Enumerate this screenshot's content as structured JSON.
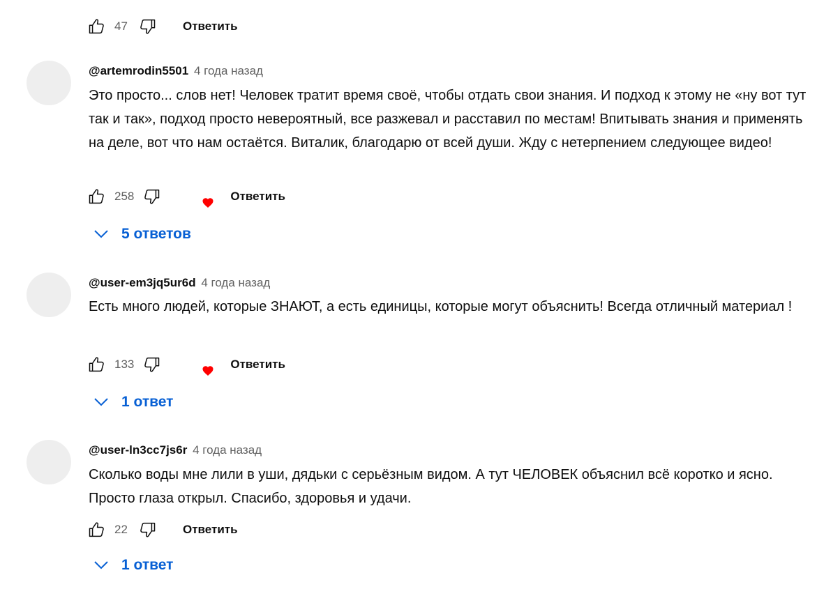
{
  "top_actions": {
    "like_count": "47",
    "reply_label": "Ответить"
  },
  "comments": [
    {
      "author": "@artemrodin5501",
      "time": "4 года назад",
      "text": "Это просто... слов нет! Человек тратит время своё, чтобы отдать свои знания. И подход к этому не «ну вот тут так и так», подход просто невероятный, все разжевал и расставил по местам! Впитывать знания и применять на деле, вот что нам остаётся. Виталик, благодарю от всей души. Жду с нетерпением следующее видео!",
      "like_count": "258",
      "reply_label": "Ответить",
      "replies_label": "5 ответов",
      "hearted": true
    },
    {
      "author": "@user-em3jq5ur6d",
      "time": "4 года назад",
      "text": "Есть много людей, которые ЗНАЮТ, а есть единицы, которые могут объяснить! Всегда отличный материал !",
      "like_count": "133",
      "reply_label": "Ответить",
      "replies_label": "1 ответ",
      "hearted": true
    },
    {
      "author": "@user-ln3cc7js6r",
      "time": "4 года назад",
      "text": "Сколько воды мне лили в уши, дядьки с серьёзным видом. А тут ЧЕЛОВЕК объяснил всё коротко и ясно. Просто глаза открыл.  Спасибо, здоровья и удачи.",
      "like_count": "22",
      "reply_label": "Ответить",
      "replies_label": "1 ответ",
      "hearted": false
    }
  ],
  "colors": {
    "link_blue": "#065fd4",
    "heart_red": "#ff0000",
    "muted_text": "#606060",
    "avatar_placeholder": "#eeeeee"
  },
  "icons": [
    "thumb-up-icon",
    "thumb-down-icon",
    "heart-icon",
    "chevron-down-icon"
  ]
}
